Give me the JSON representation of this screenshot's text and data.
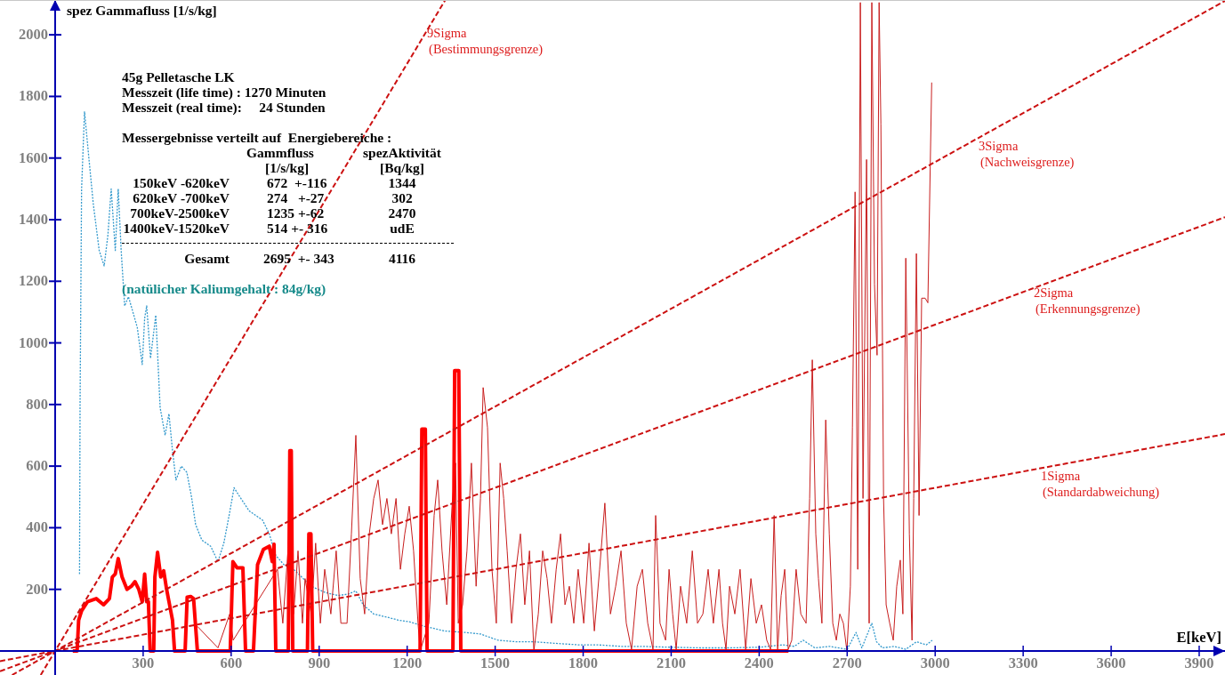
{
  "chart": {
    "chart_data": {
      "type": "line",
      "xlabel": "E[keV]",
      "ylabel": "spez Gammafluss [1/s/kg]",
      "xlim": [
        -188,
        3988
      ],
      "ylim": [
        -78,
        2113
      ],
      "xticks": [
        300,
        600,
        900,
        1200,
        1500,
        1800,
        2100,
        2400,
        2700,
        3000,
        3300,
        3600,
        3900
      ],
      "yticks": [
        200,
        400,
        600,
        800,
        1000,
        1200,
        1400,
        1600,
        1800,
        2000
      ],
      "series": [
        {
          "line_style": "dashed",
          "color": "#3399cc",
          "x": [
            83,
            85,
            90,
            100,
            115,
            130,
            150,
            167,
            180,
            191,
            205,
            215,
            225,
            237,
            250,
            265,
            280,
            297,
            305,
            312,
            325,
            343,
            358,
            375,
            388,
            400,
            412,
            430,
            449,
            465,
            479,
            500,
            530,
            555,
            575,
            595,
            610,
            630,
            661,
            707,
            730,
            752,
            780,
            813,
            840,
            873,
            920,
            965,
            1000,
            1025,
            1050,
            1086,
            1130,
            1170,
            1207,
            1260,
            1328,
            1400,
            1450,
            1510,
            1570,
            1632,
            1700,
            1784,
            1850,
            1930,
            2000,
            2100,
            2200,
            2300,
            2400,
            2481,
            2520,
            2550,
            2590,
            2640,
            2700,
            2730,
            2750,
            2784,
            2800,
            2820,
            2860,
            2900,
            2936,
            2970,
            2990
          ],
          "values": [
            250,
            800,
            1500,
            1750,
            1600,
            1450,
            1300,
            1250,
            1350,
            1500,
            1300,
            1500,
            1300,
            1120,
            1150,
            1100,
            1050,
            930,
            1080,
            1120,
            950,
            1090,
            790,
            700,
            770,
            650,
            555,
            600,
            580,
            500,
            410,
            360,
            340,
            290,
            350,
            450,
            530,
            500,
            455,
            425,
            380,
            310,
            280,
            265,
            240,
            210,
            190,
            180,
            185,
            195,
            150,
            120,
            110,
            100,
            95,
            80,
            65,
            60,
            55,
            35,
            30,
            30,
            25,
            20,
            20,
            15,
            15,
            12,
            10,
            10,
            12,
            20,
            15,
            35,
            10,
            15,
            5,
            60,
            10,
            90,
            30,
            10,
            15,
            5,
            30,
            20,
            35
          ]
        },
        {
          "line_style": "solid",
          "color": "#c81e1e",
          "x": [
            485,
            555,
            595,
            607,
            758,
            776,
            798,
            813,
            828,
            843,
            852,
            873,
            888,
            904,
            919,
            940,
            958,
            974,
            995,
            1010,
            1025,
            1040,
            1055,
            1071,
            1086,
            1101,
            1116,
            1131,
            1146,
            1162,
            1177,
            1192,
            1207,
            1222,
            1237,
            1244,
            1274,
            1292,
            1304,
            1319,
            1335,
            1353,
            1365,
            1374,
            1389,
            1404,
            1419,
            1435,
            1450,
            1459,
            1474,
            1489,
            1504,
            1517,
            1529,
            1541,
            1556,
            1571,
            1586,
            1601,
            1617,
            1632,
            1647,
            1662,
            1677,
            1692,
            1708,
            1723,
            1738,
            1753,
            1768,
            1783,
            1802,
            1820,
            1838,
            1856,
            1874,
            1893,
            1911,
            1929,
            1947,
            1965,
            1984,
            2002,
            2020,
            2038,
            2047,
            2062,
            2081,
            2093,
            2105,
            2117,
            2132,
            2153,
            2172,
            2190,
            2208,
            2226,
            2244,
            2263,
            2275,
            2287,
            2299,
            2317,
            2335,
            2354,
            2372,
            2390,
            2408,
            2426,
            2439,
            2451,
            2463,
            2475,
            2487,
            2499,
            2511,
            2526,
            2542,
            2560,
            2572,
            2581,
            2593,
            2602,
            2614,
            2627,
            2639,
            2651,
            2663,
            2675,
            2687,
            2699,
            2711,
            2718,
            2727,
            2736,
            2745,
            2754,
            2766,
            2775,
            2784,
            2793,
            2802,
            2809,
            2815,
            2824,
            2833,
            2845,
            2857,
            2869,
            2881,
            2890,
            2900,
            2912,
            2921,
            2927,
            2936,
            2945,
            2954,
            2966,
            2975,
            2988
          ],
          "values": [
            80,
            10,
            120,
            35,
            265,
            90,
            380,
            120,
            325,
            90,
            235,
            120,
            350,
            90,
            265,
            120,
            325,
            90,
            90,
            380,
            700,
            235,
            120,
            380,
            495,
            555,
            410,
            495,
            380,
            495,
            265,
            380,
            470,
            325,
            90,
            0,
            90,
            440,
            555,
            325,
            150,
            470,
            610,
            90,
            150,
            325,
            610,
            210,
            495,
            855,
            725,
            265,
            90,
            610,
            495,
            325,
            90,
            265,
            380,
            150,
            325,
            0,
            120,
            325,
            235,
            90,
            265,
            380,
            150,
            210,
            90,
            265,
            90,
            350,
            65,
            265,
            480,
            120,
            210,
            325,
            90,
            5,
            210,
            265,
            90,
            5,
            440,
            90,
            35,
            265,
            120,
            5,
            210,
            90,
            325,
            90,
            120,
            265,
            90,
            265,
            90,
            5,
            210,
            120,
            265,
            5,
            235,
            90,
            150,
            35,
            5,
            440,
            5,
            180,
            265,
            5,
            35,
            265,
            120,
            90,
            495,
            945,
            380,
            235,
            90,
            750,
            380,
            90,
            35,
            120,
            90,
            0,
            210,
            725,
            1490,
            265,
            2105,
            495,
            1595,
            90,
            2105,
            1190,
            960,
            2105,
            1710,
            495,
            150,
            90,
            35,
            210,
            295,
            120,
            1275,
            380,
            35,
            495,
            1290,
            440,
            1145,
            1145,
            1130,
            1845
          ]
        },
        {
          "line_style": "solid",
          "color": "#ff0000",
          "x": [
            60,
            75,
            80,
            90,
            110,
            140,
            165,
            185,
            195,
            205,
            215,
            228,
            245,
            260,
            272,
            285,
            297,
            305,
            312,
            318,
            324,
            336,
            340,
            349,
            360,
            370,
            380,
            390,
            400,
            407,
            443,
            450,
            462,
            472,
            485,
            597,
            606,
            620,
            640,
            649,
            676,
            690,
            710,
            730,
            740,
            746,
            752,
            795,
            800,
            805,
            810,
            860,
            865,
            872,
            878,
            1244,
            1250,
            1262,
            1268,
            1356,
            1362,
            1376,
            1383,
            2500
          ],
          "values": [
            0,
            0,
            100,
            130,
            160,
            170,
            150,
            170,
            240,
            250,
            300,
            240,
            200,
            210,
            225,
            200,
            160,
            250,
            160,
            160,
            0,
            0,
            240,
            320,
            240,
            260,
            200,
            150,
            100,
            0,
            0,
            175,
            177,
            170,
            0,
            0,
            290,
            270,
            270,
            0,
            0,
            280,
            330,
            340,
            290,
            346,
            0,
            0,
            650,
            650,
            0,
            0,
            380,
            380,
            0,
            0,
            720,
            720,
            0,
            0,
            910,
            910,
            0,
            0
          ]
        },
        {
          "line_style": "dashed",
          "color": "#cc1111",
          "x": [
            -49,
            1330
          ],
          "values": [
            -78,
            2113
          ]
        },
        {
          "line_style": "dashed",
          "color": "#cc1111",
          "x": [
            -147,
            3988
          ],
          "values": [
            -78,
            2110
          ]
        },
        {
          "line_style": "dashed",
          "color": "#cc1111",
          "x": [
            -188,
            3988
          ],
          "values": [
            -66,
            1408
          ]
        },
        {
          "line_style": "dashed",
          "color": "#cc1111",
          "x": [
            -188,
            3988
          ],
          "values": [
            -33,
            704
          ]
        }
      ],
      "annotations": [
        "9Sigma",
        "(Bestimmungsgrenze)",
        "3Sigma",
        "(Nachweisgrenze)",
        "2Sigma",
        "(Erkennungsgrenze)",
        "1Sigma",
        "(Standardabweichung)"
      ]
    },
    "info_panel": {
      "title": "45g Pelletasche LK",
      "lines": [
        "Messzeit (life time) : 1270 Minuten",
        "Messzeit (real time):     24 Stunden"
      ],
      "results_heading": "Messergebnisse verteilt auf  Energiebereiche :",
      "columns": [
        null,
        {
          "label": "Gammfluss",
          "unit": "[1/s/kg]"
        },
        {
          "label": "spezAktivität",
          "unit": "[Bq/kg]"
        }
      ],
      "rows": [
        [
          "150keV -620keV",
          "672  +-116",
          "1344"
        ],
        [
          "620keV -700keV",
          "274   +-27",
          "302"
        ],
        [
          "700keV-2500keV",
          "1235 +-62",
          "2470"
        ],
        [
          "1400keV-1520keV",
          "514 +- 316",
          "udE"
        ]
      ],
      "total": [
        "Gesamt",
        "2695  +- 343",
        "4116"
      ],
      "note": "(natülicher Kaliumgehalt : 84g/kg)"
    }
  }
}
